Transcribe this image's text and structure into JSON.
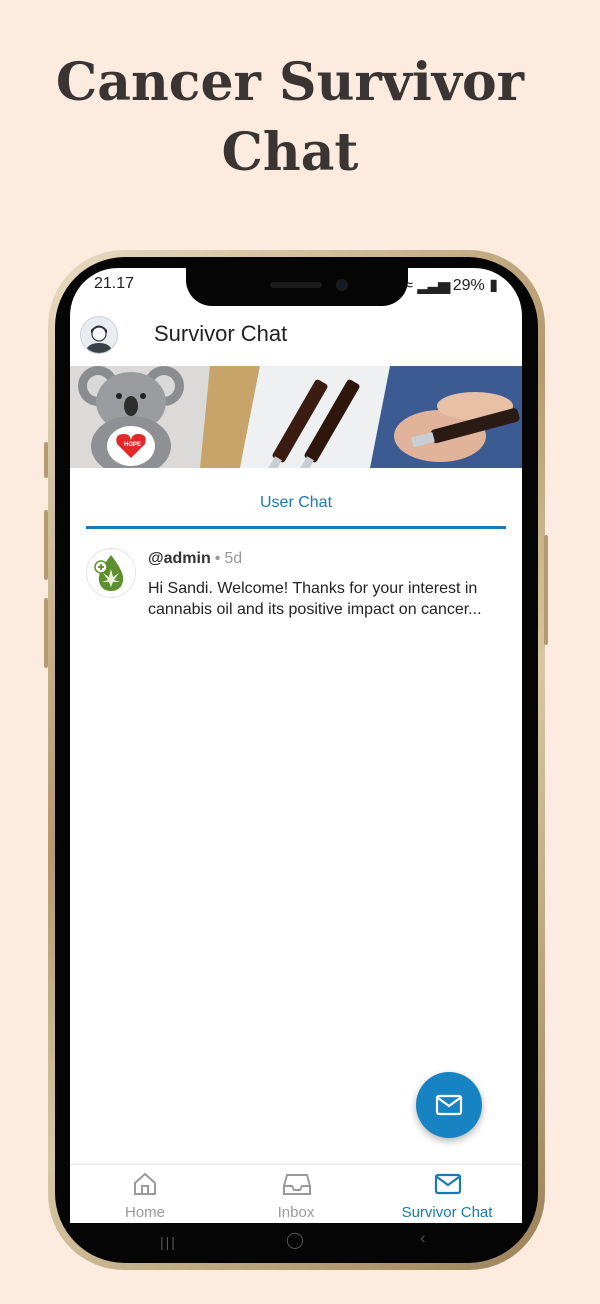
{
  "promo": {
    "headline_line1": "Cancer Survivor",
    "headline_line2": "Chat"
  },
  "status_bar": {
    "time": "21.17",
    "battery": "29%"
  },
  "app_bar": {
    "title": "Survivor Chat"
  },
  "tabs": {
    "active_label": "User Chat"
  },
  "messages": [
    {
      "username": "@admin",
      "time": "5d",
      "body": "Hi Sandi. Welcome! Thanks for your interest in cannabis oil and its positive impact on cancer..."
    }
  ],
  "banner": {
    "badge_text": "HOPE"
  },
  "bottom_nav": [
    {
      "label": "Home",
      "icon": "home-icon"
    },
    {
      "label": "Inbox",
      "icon": "inbox-icon"
    },
    {
      "label": "Survivor Chat",
      "icon": "mail-icon"
    }
  ],
  "colors": {
    "accent": "#1a7ab8",
    "fab": "#1783c2",
    "page_background": "#fdebdf",
    "headline": "#3a3533"
  }
}
